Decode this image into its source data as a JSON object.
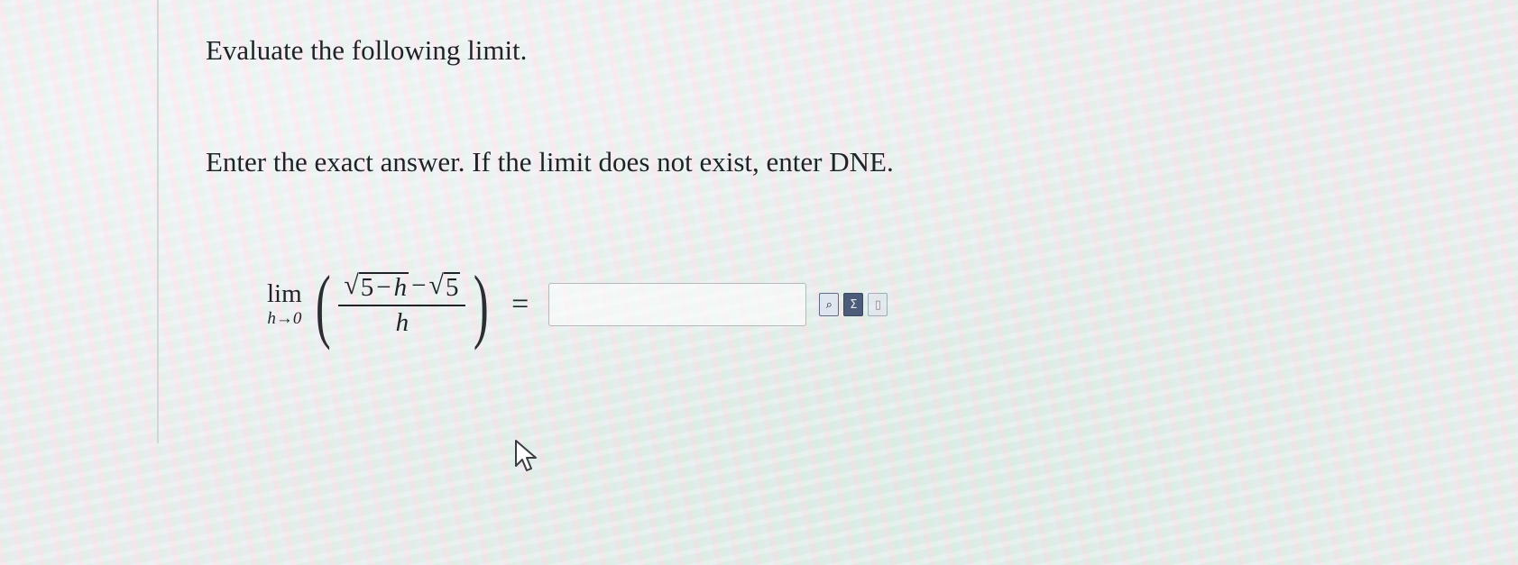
{
  "question": {
    "prompt": "Evaluate the following limit.",
    "instructions": "Enter the exact answer. If the limit does not exist, enter DNE."
  },
  "expression": {
    "lim_label": "lim",
    "lim_subscript": "h→0",
    "numerator": {
      "first_sqrt": {
        "number": "5",
        "operator": "−",
        "variable": "h"
      },
      "operator": "−",
      "second_sqrt": {
        "number": "5"
      }
    },
    "denominator": "h",
    "equals": "="
  },
  "answer": {
    "value": "",
    "placeholder": ""
  },
  "toolbar": {
    "icons": [
      "equation-editor-icon",
      "sum-editor-icon",
      "help-document-icon"
    ]
  }
}
